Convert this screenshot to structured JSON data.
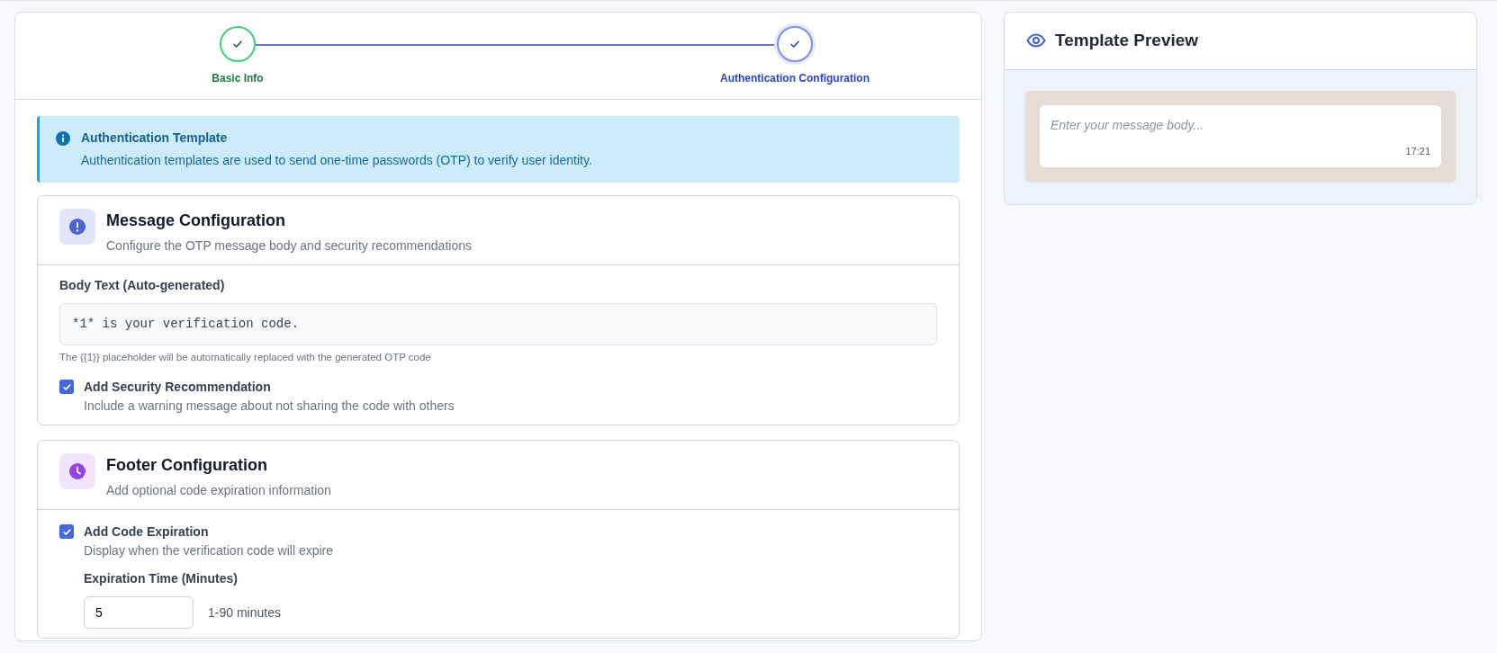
{
  "steps": [
    {
      "label": "Basic Info",
      "selected": false
    },
    {
      "label": "Authentication Configuration",
      "selected": true
    }
  ],
  "alert": {
    "title": "Authentication Template",
    "text": "Authentication templates are used to send one-time passwords (OTP) to verify user identity."
  },
  "sections": [
    {
      "kind": "message",
      "title": "Message Configuration",
      "subtitle": "Configure the OTP message body and security recommendations",
      "body_label": "Body Text (Auto-generated)",
      "body_value": "*1* is your verification code.",
      "body_help": "The {{1}} placeholder will be automatically replaced with the generated OTP code",
      "option": {
        "label": "Add Security Recommendation",
        "description": "Include a warning message about not sharing the code with others",
        "checked": true
      }
    },
    {
      "kind": "footer",
      "title": "Footer Configuration",
      "subtitle": "Add optional code expiration information",
      "option": {
        "label": "Add Code Expiration",
        "description": "Display when the verification code will expire",
        "checked": true
      },
      "expiration": {
        "label": "Expiration Time (Minutes)",
        "value": "5",
        "hint": "1-90 minutes"
      }
    }
  ],
  "preview": {
    "title": "Template Preview",
    "empty_body_text": "Enter your message body...",
    "time": "17:21"
  }
}
